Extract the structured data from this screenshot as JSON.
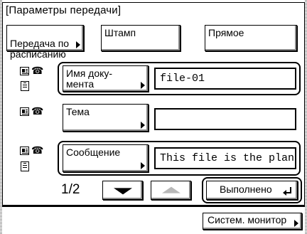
{
  "header": {
    "title": "[Параметры передачи]"
  },
  "options": {
    "schedule_label": "Передача по расписанию",
    "stamp_label": "Штамп",
    "direct_label": "Прямое"
  },
  "rows": [
    {
      "button_label": "Имя доку-\nмента",
      "value": "file-01"
    },
    {
      "button_label": "Тема",
      "value": ""
    },
    {
      "button_label": "Сообщение",
      "value": "This file is the plan o"
    }
  ],
  "pager": {
    "page_indicator": "1/2"
  },
  "done_label": "Выполнено",
  "footer": {
    "monitor_label": "Систем. монитор"
  }
}
